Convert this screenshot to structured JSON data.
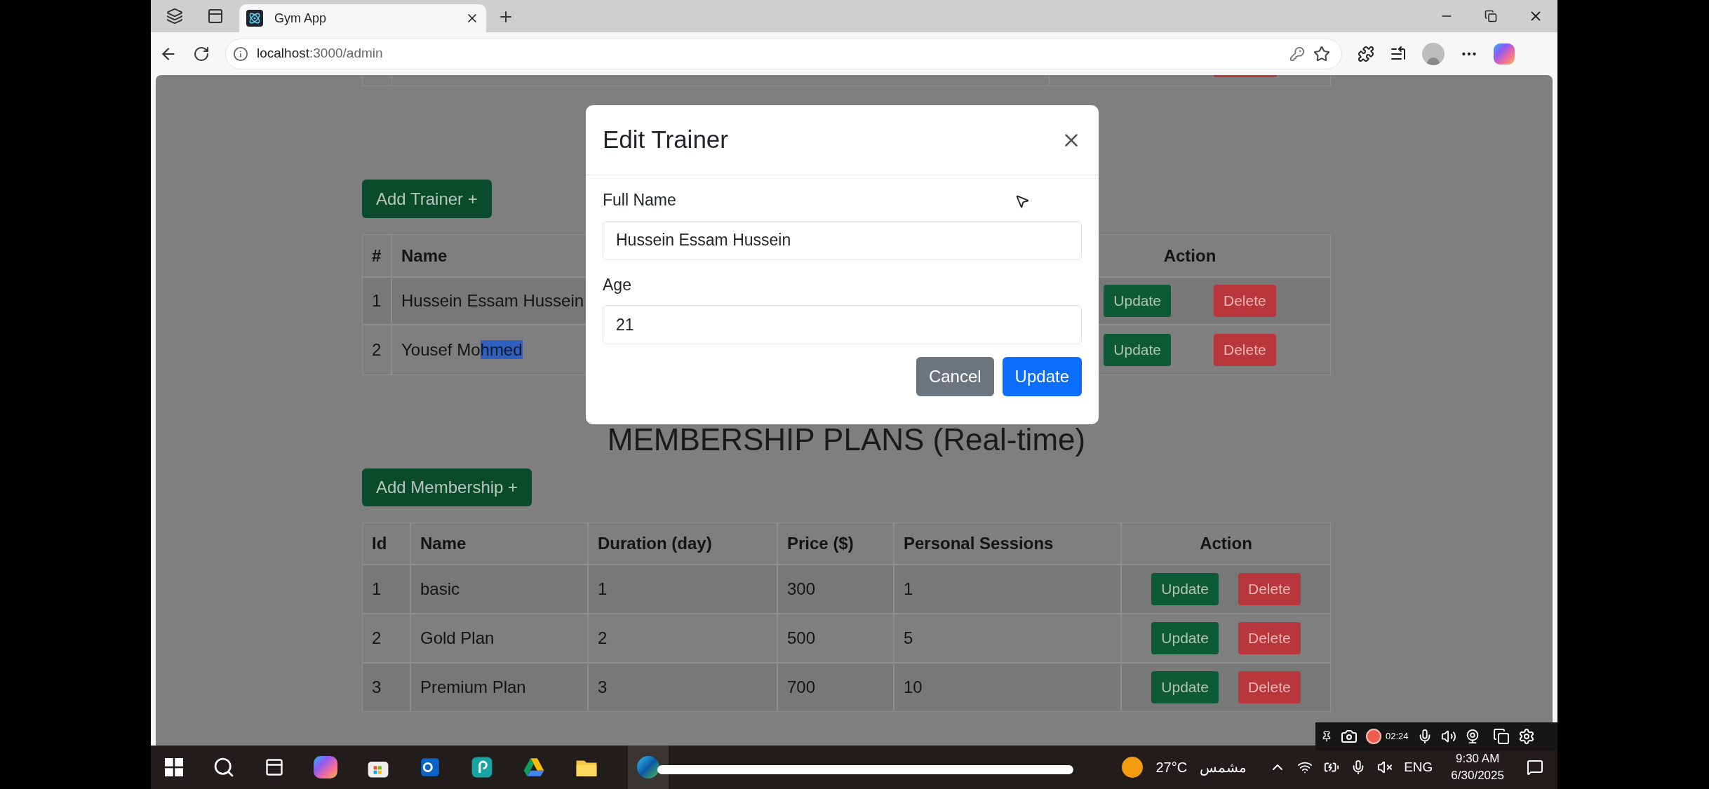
{
  "browser": {
    "tab_title": "Gym App",
    "url_host": "localhost",
    "url_path": ":3000/admin"
  },
  "trainers": {
    "add_button": "Add Trainer +",
    "columns": [
      "#",
      "Name",
      "Action"
    ],
    "rows": [
      {
        "id": "1",
        "name": [
          {
            "text": "Hussein Essam Hussein",
            "selected": false
          }
        ],
        "actions": [
          {
            "label": "Update",
            "kind": "update"
          },
          {
            "label": "Delete",
            "kind": "delete"
          }
        ]
      },
      {
        "id": "2",
        "name": [
          {
            "text": "Yousef Mo",
            "selected": false
          },
          {
            "text": "hmed",
            "selected": true
          }
        ],
        "actions": [
          {
            "label": "Update",
            "kind": "update"
          },
          {
            "label": "Delete",
            "kind": "delete"
          }
        ]
      }
    ]
  },
  "memberships": {
    "title": "MEMBERSHIP PLANS (Real-time)",
    "add_button": "Add Membership +",
    "columns": [
      "Id",
      "Name",
      "Duration (day)",
      "Price ($)",
      "Personal Sessions",
      "Action"
    ],
    "rows": [
      {
        "cells": [
          "1",
          "basic",
          "1",
          "300",
          "1"
        ],
        "actions": [
          {
            "label": "Update",
            "kind": "update"
          },
          {
            "label": "Delete",
            "kind": "delete"
          }
        ]
      },
      {
        "cells": [
          "2",
          "Gold Plan",
          "2",
          "500",
          "5"
        ],
        "actions": [
          {
            "label": "Update",
            "kind": "update"
          },
          {
            "label": "Delete",
            "kind": "delete"
          }
        ]
      },
      {
        "cells": [
          "3",
          "Premium Plan",
          "3",
          "700",
          "10"
        ],
        "actions": [
          {
            "label": "Update",
            "kind": "update"
          },
          {
            "label": "Delete",
            "kind": "delete"
          }
        ]
      }
    ]
  },
  "modal": {
    "title": "Edit Trainer",
    "fields": [
      {
        "label": "Full Name",
        "value": "Hussein Essam Hussein"
      },
      {
        "label": "Age",
        "value": "21"
      }
    ],
    "buttons": [
      {
        "label": "Cancel",
        "kind": "secondary"
      },
      {
        "label": "Update",
        "kind": "primary"
      }
    ]
  },
  "recorder": {
    "timer": "02:24"
  },
  "taskbar": {
    "temperature": "27°C",
    "condition": "مشمس",
    "language": "ENG",
    "time": "9:30 AM",
    "date": "6/30/2025"
  }
}
